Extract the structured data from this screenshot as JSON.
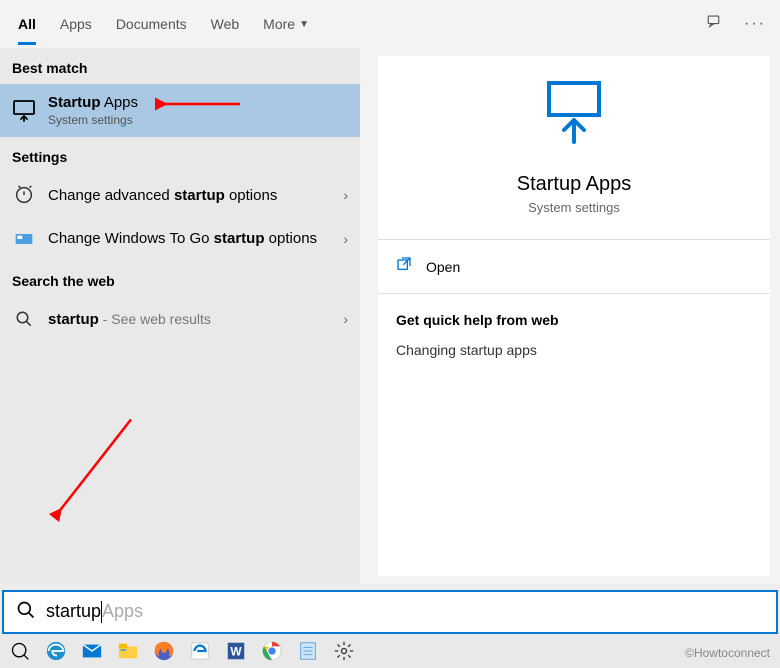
{
  "tabs": {
    "all": "All",
    "apps": "Apps",
    "documents": "Documents",
    "web": "Web",
    "more": "More"
  },
  "sections": {
    "best_match": "Best match",
    "settings": "Settings",
    "search_web": "Search the web"
  },
  "results": {
    "startup_apps": {
      "title_pre": "Startup",
      "title_post": " Apps",
      "subtitle": "System settings"
    },
    "adv_startup": {
      "pre": "Change advanced ",
      "bold": "startup",
      "post": " options"
    },
    "togo": {
      "pre": "Change Windows To Go ",
      "bold": "startup",
      "post": " options"
    },
    "web_startup": {
      "bold": "startup",
      "post": " - See web results"
    }
  },
  "preview": {
    "title": "Startup Apps",
    "subtitle": "System settings",
    "open": "Open",
    "quick_help_header": "Get quick help from web",
    "link1": "Changing startup apps"
  },
  "search": {
    "typed": "startup",
    "ghost": "Apps"
  },
  "watermark": "©Howtoconnect"
}
